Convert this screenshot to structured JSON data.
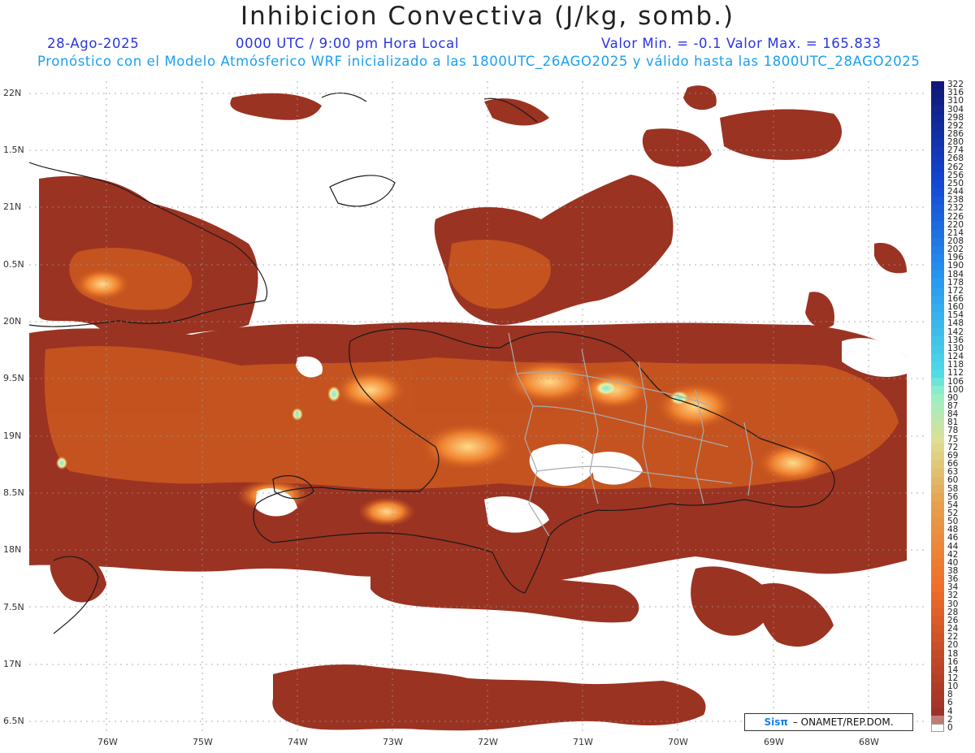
{
  "title": "Inhibicion Convectiva (J/kg, somb.)",
  "header": {
    "date": "28-Ago-2025",
    "time": "0000 UTC / 9:00 pm Hora Local",
    "minmax": "Valor Min. = -0.1  Valor Max. = 165.833",
    "forecast": "Pronóstico con el Modelo Atmósferico WRF inicializado a las 1800UTC_26AGO2025 y válido hasta las  1800UTC_28AGO2025"
  },
  "lat_labels": [
    "22N",
    "1.5N",
    "21N",
    "0.5N",
    "20N",
    "9.5N",
    "19N",
    "8.5N",
    "18N",
    "7.5N",
    "17N",
    "6.5N"
  ],
  "lon_labels": [
    "76W",
    "75W",
    "74W",
    "73W",
    "72W",
    "71W",
    "70W",
    "69W",
    "68W"
  ],
  "colorbar": {
    "labels": [
      "322",
      "316",
      "310",
      "304",
      "298",
      "292",
      "286",
      "280",
      "274",
      "268",
      "262",
      "256",
      "250",
      "244",
      "238",
      "232",
      "226",
      "220",
      "214",
      "208",
      "202",
      "196",
      "190",
      "184",
      "178",
      "172",
      "166",
      "160",
      "154",
      "148",
      "142",
      "136",
      "130",
      "124",
      "118",
      "112",
      "106",
      "100",
      "90",
      "87",
      "84",
      "81",
      "78",
      "75",
      "72",
      "69",
      "66",
      "63",
      "60",
      "58",
      "56",
      "54",
      "52",
      "50",
      "48",
      "46",
      "44",
      "42",
      "40",
      "38",
      "36",
      "34",
      "32",
      "30",
      "28",
      "26",
      "24",
      "22",
      "20",
      "18",
      "16",
      "14",
      "12",
      "10",
      "8",
      "6",
      "4",
      "2",
      "0"
    ]
  },
  "credit": {
    "logo": "Sisπ",
    "text": "– ONAMET/REP.DOM."
  }
}
